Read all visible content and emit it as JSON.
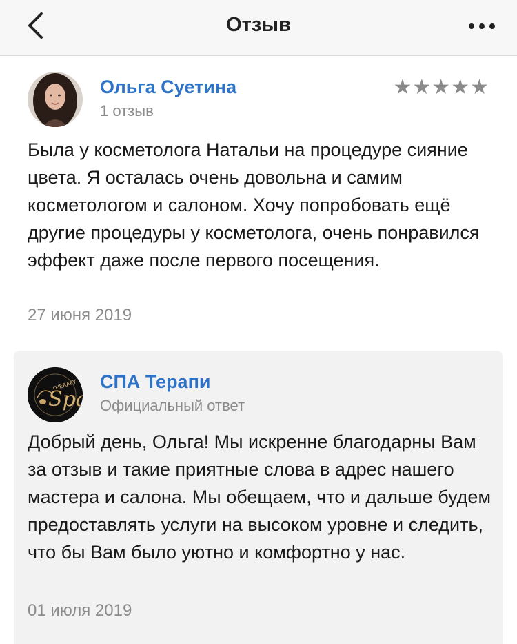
{
  "header": {
    "title": "Отзыв",
    "back_icon": "chevron-left-icon",
    "more_icon": "ellipsis-icon"
  },
  "review": {
    "author_name": "Ольга Суетина",
    "author_reviews": "1 отзыв",
    "rating": 5,
    "rating_max": 5,
    "stars": "★★★★★",
    "text": "Была у косметолога Натальи на процедуре сияние цвета. Я осталась очень довольна и самим косметологом и салоном. Хочу попробовать ещё другие процедуры у косметолога, очень понравился эффект даже после первого посещения.",
    "date": "27 июня 2019"
  },
  "reply": {
    "author_name": "СПА Терапи",
    "label": "Официальный ответ",
    "logo_text": "Spa",
    "logo_subtext": "THERAPY",
    "text": "Добрый день, Ольга! Мы искренне благодарны Вам за отзыв и такие приятные слова в адрес нашего мастера и салона. Мы обещаем, что и дальше будем предоставлять услуги на высоком уровне и следить, что бы Вам было уютно и комфортно у нас.",
    "date": "01 июля 2019"
  },
  "colors": {
    "link_blue": "#2f73c9",
    "muted_gray": "#8a8a8a",
    "reply_bg": "#f2f2f2",
    "header_bg": "#f7f7f7"
  }
}
